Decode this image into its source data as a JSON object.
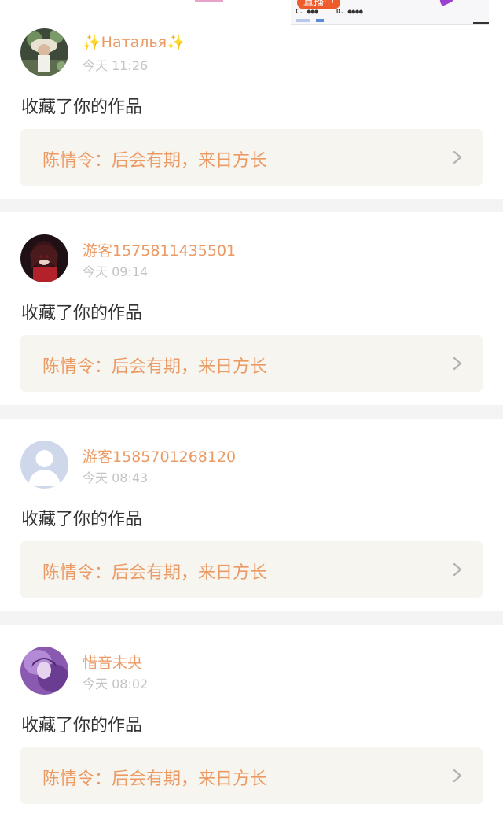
{
  "banner": {
    "live_badge": "直播中",
    "option_c": "C. ●●●",
    "option_d": "D. ●●●●"
  },
  "notifications": [
    {
      "username": "✨Наталья✨",
      "time": "今天 11:26",
      "action": "收藏了你的作品",
      "work": "陈情令：后会有期，来日方长",
      "avatar": "avatar-photo-hat"
    },
    {
      "username": "游客1575811435501",
      "time": "今天 09:14",
      "action": "收藏了你的作品",
      "work": "陈情令：后会有期，来日方长",
      "avatar": "avatar-anime-red"
    },
    {
      "username": "游客1585701268120",
      "time": "今天 08:43",
      "action": "收藏了你的作品",
      "work": "陈情令：后会有期，来日方长",
      "avatar": "avatar-default-silhouette"
    },
    {
      "username": "惜音未央",
      "time": "今天 08:02",
      "action": "收藏了你的作品",
      "work": "陈情令：后会有期，来日方长",
      "avatar": "avatar-purple-anime"
    }
  ],
  "colors": {
    "accent": "#ec9a64",
    "muted": "#c4c4c4",
    "text": "#333333",
    "card_bg": "#f6f5ef",
    "divider": "#f4f4f4"
  },
  "icons": {
    "chevron": "chevron-right-icon"
  }
}
